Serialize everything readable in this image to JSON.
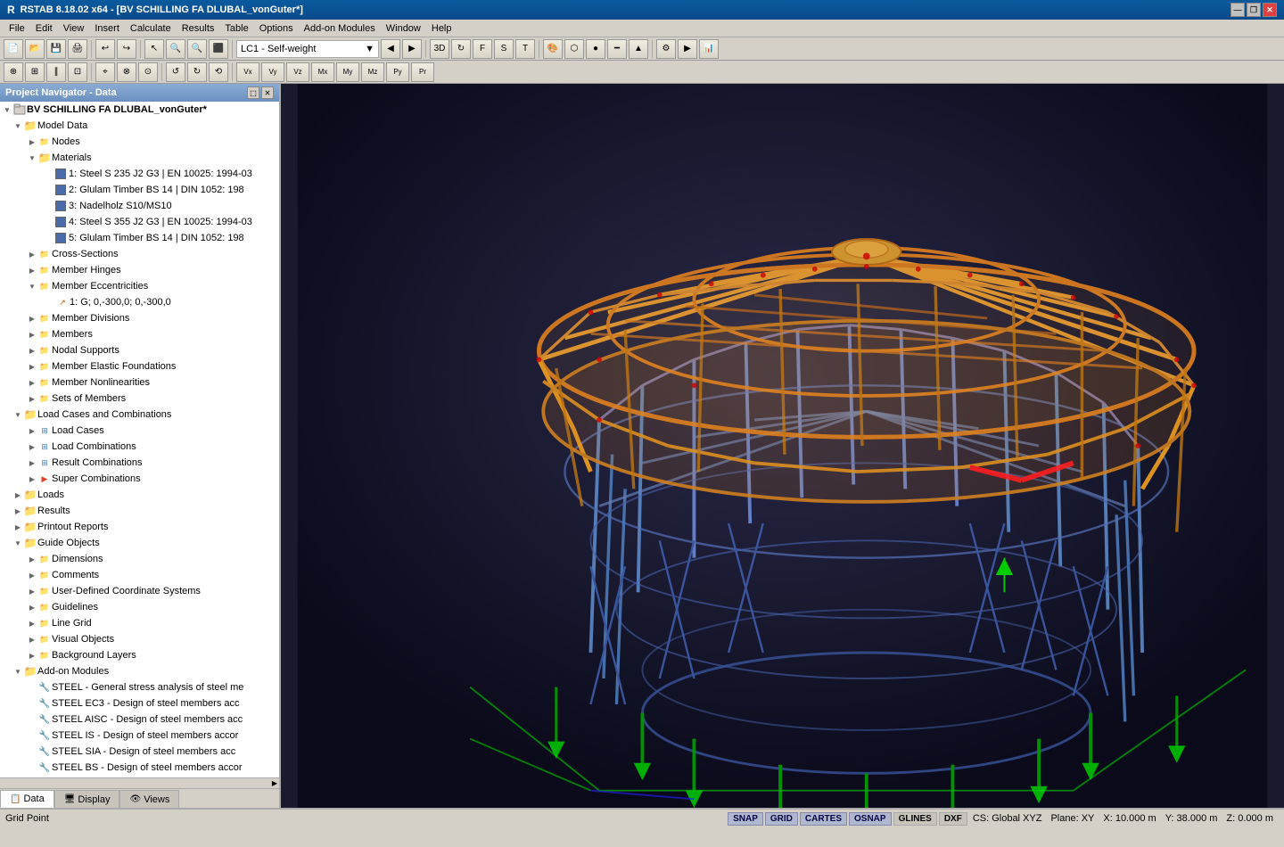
{
  "window": {
    "title": "RSTAB 8.18.02 x64 - [BV SCHILLING FA DLUBAL_vonGuter*]",
    "app_icon": "R"
  },
  "title_bar": {
    "title": "RSTAB 8.18.02 x64 - [BV SCHILLING FA DLUBAL_vonGuter*]",
    "minimize": "—",
    "maximize": "□",
    "close": "✕",
    "restore": "❐"
  },
  "menu": {
    "items": [
      "File",
      "Edit",
      "View",
      "Insert",
      "Calculate",
      "Results",
      "Table",
      "Options",
      "Add-on Modules",
      "Window",
      "Help"
    ]
  },
  "toolbar": {
    "load_case_dropdown": "LC1 - Self-weight"
  },
  "navigator": {
    "title": "Project Navigator - Data",
    "tree": [
      {
        "id": "root",
        "label": "BV SCHILLING FA DLUBAL_vonGuter*",
        "indent": 0,
        "type": "root",
        "expanded": true
      },
      {
        "id": "model_data",
        "label": "Model Data",
        "indent": 1,
        "type": "folder",
        "expanded": true
      },
      {
        "id": "nodes",
        "label": "Nodes",
        "indent": 2,
        "type": "folder-item"
      },
      {
        "id": "materials",
        "label": "Materials",
        "indent": 2,
        "type": "folder",
        "expanded": true
      },
      {
        "id": "mat1",
        "label": "1: Steel S 235 J2 G3 | EN 10025: 1994-03",
        "indent": 3,
        "type": "material",
        "color": "#4060a0"
      },
      {
        "id": "mat2",
        "label": "2: Glulam Timber BS 14 | DIN 1052: 198",
        "indent": 3,
        "type": "material",
        "color": "#4060a0"
      },
      {
        "id": "mat3",
        "label": "3: Nadelholz S10/MS10",
        "indent": 3,
        "type": "material",
        "color": "#4060a0"
      },
      {
        "id": "mat4",
        "label": "4: Steel S 355 J2 G3 | EN 10025: 1994-03",
        "indent": 3,
        "type": "material",
        "color": "#4060a0"
      },
      {
        "id": "mat5",
        "label": "5: Glulam Timber BS 14 | DIN 1052: 198",
        "indent": 3,
        "type": "material",
        "color": "#4060a0"
      },
      {
        "id": "cross_sections",
        "label": "Cross-Sections",
        "indent": 2,
        "type": "folder-item"
      },
      {
        "id": "member_hinges",
        "label": "Member Hinges",
        "indent": 2,
        "type": "folder-item"
      },
      {
        "id": "member_eccentricities",
        "label": "Member Eccentricities",
        "indent": 2,
        "type": "folder",
        "expanded": true
      },
      {
        "id": "ecc1",
        "label": "1: G; 0,-300,0; 0,-300,0",
        "indent": 3,
        "type": "eccentricity"
      },
      {
        "id": "member_divisions",
        "label": "Member Divisions",
        "indent": 2,
        "type": "folder-item"
      },
      {
        "id": "members",
        "label": "Members",
        "indent": 2,
        "type": "folder-item"
      },
      {
        "id": "nodal_supports",
        "label": "Nodal Supports",
        "indent": 2,
        "type": "folder-item"
      },
      {
        "id": "member_elastic",
        "label": "Member Elastic Foundations",
        "indent": 2,
        "type": "folder-item"
      },
      {
        "id": "member_nonlinearities",
        "label": "Member Nonlinearities",
        "indent": 2,
        "type": "folder-item"
      },
      {
        "id": "sets_of_members",
        "label": "Sets of Members",
        "indent": 2,
        "type": "folder-item"
      },
      {
        "id": "load_cases",
        "label": "Load Cases and Combinations",
        "indent": 1,
        "type": "folder",
        "expanded": true
      },
      {
        "id": "lc_load_cases",
        "label": "Load Cases",
        "indent": 2,
        "type": "folder-item"
      },
      {
        "id": "load_combinations",
        "label": "Load Combinations",
        "indent": 2,
        "type": "folder-item"
      },
      {
        "id": "result_combinations",
        "label": "Result Combinations",
        "indent": 2,
        "type": "folder-item"
      },
      {
        "id": "super_combinations",
        "label": "Super Combinations",
        "indent": 2,
        "type": "folder-item"
      },
      {
        "id": "loads",
        "label": "Loads",
        "indent": 1,
        "type": "folder-item"
      },
      {
        "id": "results",
        "label": "Results",
        "indent": 1,
        "type": "folder-item"
      },
      {
        "id": "printout_reports",
        "label": "Printout Reports",
        "indent": 1,
        "type": "folder-item"
      },
      {
        "id": "guide_objects",
        "label": "Guide Objects",
        "indent": 1,
        "type": "folder",
        "expanded": true
      },
      {
        "id": "dimensions",
        "label": "Dimensions",
        "indent": 2,
        "type": "folder-item"
      },
      {
        "id": "comments",
        "label": "Comments",
        "indent": 2,
        "type": "folder-item"
      },
      {
        "id": "user_coord",
        "label": "User-Defined Coordinate Systems",
        "indent": 2,
        "type": "folder-item"
      },
      {
        "id": "guidelines",
        "label": "Guidelines",
        "indent": 2,
        "type": "folder-item"
      },
      {
        "id": "line_grid",
        "label": "Line Grid",
        "indent": 2,
        "type": "folder-item"
      },
      {
        "id": "visual_objects",
        "label": "Visual Objects",
        "indent": 2,
        "type": "folder-item"
      },
      {
        "id": "background_layers",
        "label": "Background Layers",
        "indent": 2,
        "type": "folder-item"
      },
      {
        "id": "addon_modules",
        "label": "Add-on Modules",
        "indent": 1,
        "type": "folder",
        "expanded": true
      },
      {
        "id": "steel_general",
        "label": "STEEL - General stress analysis of steel me",
        "indent": 2,
        "type": "addon"
      },
      {
        "id": "steel_ec3",
        "label": "STEEL EC3 - Design of steel members acc",
        "indent": 2,
        "type": "addon"
      },
      {
        "id": "steel_aisc",
        "label": "STEEL AISC - Design of steel members acc",
        "indent": 2,
        "type": "addon"
      },
      {
        "id": "steel_is",
        "label": "STEEL IS - Design of steel members accor",
        "indent": 2,
        "type": "addon"
      },
      {
        "id": "steel_sia",
        "label": "STEEL SIA - Design of steel members acc",
        "indent": 2,
        "type": "addon"
      },
      {
        "id": "steel_bs",
        "label": "STEEL BS - Design of steel members accor",
        "indent": 2,
        "type": "addon"
      }
    ]
  },
  "panel_tabs": [
    "Data",
    "Display",
    "Views"
  ],
  "status_bar": {
    "left_label": "Grid Point",
    "snap_buttons": [
      "SNAP",
      "GRID",
      "CARTES",
      "OSNAP",
      "GLINES",
      "DXF"
    ],
    "active_snaps": [
      "SNAP",
      "GRID",
      "CARTES",
      "OSNAP"
    ],
    "coord_system": "CS: Global XYZ",
    "plane": "Plane: XY",
    "x": "X: 10.000 m",
    "y": "Y: 38.000 m",
    "z": "Z: 0.000 m"
  }
}
